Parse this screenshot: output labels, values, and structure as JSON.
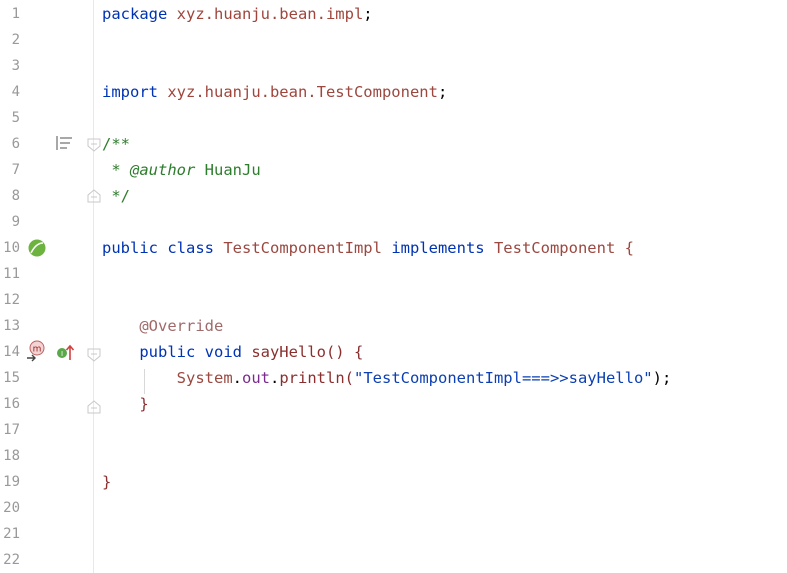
{
  "lines": [
    {
      "n": "1",
      "code": [
        {
          "t": "package ",
          "c": "kw"
        },
        {
          "t": "xyz.huanju.bean.impl",
          "c": "pkg"
        },
        {
          "t": ";",
          "c": ""
        }
      ]
    },
    {
      "n": "2",
      "code": []
    },
    {
      "n": "3",
      "code": []
    },
    {
      "n": "4",
      "code": [
        {
          "t": "import ",
          "c": "kw"
        },
        {
          "t": "xyz.huanju.bean.",
          "c": "pkg"
        },
        {
          "t": "TestComponent",
          "c": "cls"
        },
        {
          "t": ";",
          "c": ""
        }
      ]
    },
    {
      "n": "5",
      "code": []
    },
    {
      "n": "6",
      "code": [
        {
          "t": "/**",
          "c": "cmt"
        }
      ]
    },
    {
      "n": "7",
      "code": [
        {
          "t": " * ",
          "c": "cmt"
        },
        {
          "t": "@author",
          "c": "tag"
        },
        {
          "t": " HuanJu",
          "c": "cmt"
        }
      ]
    },
    {
      "n": "8",
      "code": [
        {
          "t": " */",
          "c": "cmt"
        }
      ]
    },
    {
      "n": "9",
      "code": []
    },
    {
      "n": "10",
      "code": [
        {
          "t": "public class ",
          "c": "kw"
        },
        {
          "t": "TestComponentImpl ",
          "c": "cls"
        },
        {
          "t": "implements ",
          "c": "kw"
        },
        {
          "t": "TestComponent {",
          "c": "cls"
        }
      ]
    },
    {
      "n": "11",
      "code": []
    },
    {
      "n": "12",
      "code": []
    },
    {
      "n": "13",
      "code": [
        {
          "t": "    ",
          "c": ""
        },
        {
          "t": "@Override",
          "c": "ann"
        }
      ]
    },
    {
      "n": "14",
      "code": [
        {
          "t": "    ",
          "c": ""
        },
        {
          "t": "public void ",
          "c": "kw"
        },
        {
          "t": "sayHello() {",
          "c": "fn"
        }
      ]
    },
    {
      "n": "15",
      "code": [
        {
          "t": "        ",
          "c": ""
        },
        {
          "t": "System",
          "c": "cls"
        },
        {
          "t": ".",
          "c": ""
        },
        {
          "t": "out",
          "c": "fld"
        },
        {
          "t": ".",
          "c": ""
        },
        {
          "t": "println(",
          "c": "fn"
        },
        {
          "t": "\"TestComponentImpl===>>sayHello\"",
          "c": "str"
        },
        {
          "t": ");",
          "c": ""
        }
      ]
    },
    {
      "n": "16",
      "code": [
        {
          "t": "    ",
          "c": ""
        },
        {
          "t": "}",
          "c": "fn"
        }
      ]
    },
    {
      "n": "17",
      "code": []
    },
    {
      "n": "18",
      "code": []
    },
    {
      "n": "19",
      "code": [
        {
          "t": "}",
          "c": "fn"
        }
      ]
    },
    {
      "n": "20",
      "code": []
    },
    {
      "n": "21",
      "code": []
    },
    {
      "n": "22",
      "code": []
    }
  ],
  "gutter_icons": {
    "doc_render": "doc-render-icon",
    "spring_bean": "spring-bean-icon",
    "override_method": "override-method-icon",
    "implements_method": "implements-method-icon",
    "fold": "fold-icon"
  },
  "gutter_badges": {
    "method_badge": "m",
    "interface_badge": "I"
  },
  "colors": {
    "keyword": "#0033b3",
    "package": "#a0453c",
    "class": "#9b4840",
    "comment": "#2e7d2e",
    "annotation": "#a06a6a",
    "string": "#0b3fb3",
    "field": "#7a2a8c",
    "line_number": "#999999",
    "spring_green": "#6db33f"
  }
}
